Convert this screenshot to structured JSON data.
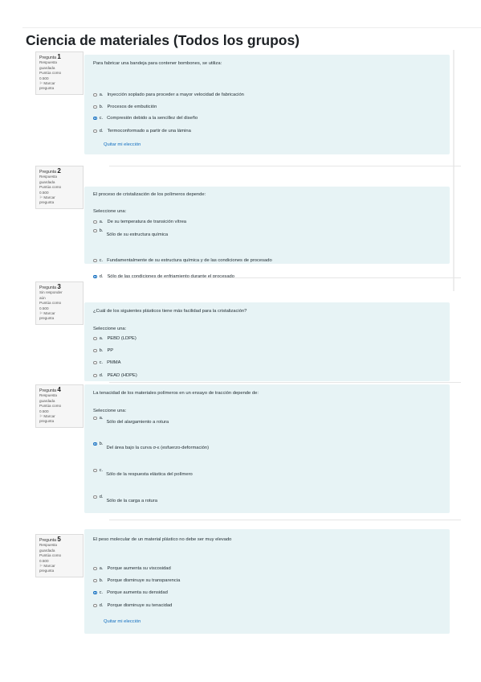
{
  "title": "Ciencia de materiales (Todos los grupos)",
  "q_label": "Pregunta",
  "questions": [
    {
      "number": "1",
      "status": [
        "Respuesta",
        "guardada"
      ],
      "points": [
        "Puntúa como",
        "0.500"
      ],
      "flag": [
        "Marcar",
        "pregunta"
      ],
      "text": "Para fabricar una bandeja para contener bombones, se utiliza:",
      "prompt": "",
      "options": [
        {
          "letter": "a.",
          "text": "Inyección soplado para proceder a mayor velocidad de fabricación",
          "selected": false
        },
        {
          "letter": "b.",
          "text": "Procesos de embutición",
          "selected": false
        },
        {
          "letter": "c.",
          "text": "Compresión debido a la sencillez del diseño",
          "selected": true
        },
        {
          "letter": "d.",
          "text": "Termoconformado a partir de una lámina",
          "selected": false
        }
      ],
      "clear": "Quitar mi elección"
    },
    {
      "number": "2",
      "status": [
        "Respuesta",
        "guardada"
      ],
      "points": [
        "Puntúa como",
        "0.500"
      ],
      "flag": [
        "Marcar",
        "pregunta"
      ],
      "text": "El proceso de cristalización de los polímeros depende:",
      "prompt": "Seleccione una:",
      "options": [
        {
          "letter": "a.",
          "text": "De su temperatura de transición vítrea",
          "selected": false
        },
        {
          "letter": "b.",
          "text": "Sólo de su estructura química",
          "selected": false
        },
        {
          "letter": "c.",
          "text": "Fundamentalmente de su estructura química y de las condiciones de procesado",
          "selected": false
        },
        {
          "letter": "d.",
          "text": "Sólo de las condiciones de enfriamiento durante el procesado",
          "selected": true
        }
      ],
      "clear": ""
    },
    {
      "number": "3",
      "status": [
        "Sin responder",
        "aún"
      ],
      "points": [
        "Puntúa como",
        "0.500"
      ],
      "flag": [
        "Marcar",
        "pregunta"
      ],
      "text": "¿Cuál de los siguientes plásticos tiene más facilidad para la cristalización?",
      "prompt": "Seleccione una:",
      "options": [
        {
          "letter": "a.",
          "text": "PEBD (LDPE)",
          "selected": false
        },
        {
          "letter": "b.",
          "text": "PP",
          "selected": false
        },
        {
          "letter": "c.",
          "text": "PMMA",
          "selected": false
        },
        {
          "letter": "d.",
          "text": "PEAD (HDPE)",
          "selected": false
        }
      ],
      "clear": ""
    },
    {
      "number": "4",
      "status": [
        "Respuesta",
        "guardada"
      ],
      "points": [
        "Puntúa como",
        "0.500"
      ],
      "flag": [
        "Marcar",
        "pregunta"
      ],
      "text": "La tenacidad de los materiales polímeros en un ensayo de tracción depende de:",
      "prompt": "Seleccione una:",
      "options": [
        {
          "letter": "a.",
          "text": "Sólo del alargamiento a rotura",
          "selected": false
        },
        {
          "letter": "b.",
          "text": "Del área bajo la curva σ-ε (esfuerzo-deformación)",
          "selected": true
        },
        {
          "letter": "c.",
          "text": "Sólo de la respuesta elástica del polímero",
          "selected": false
        },
        {
          "letter": "d.",
          "text": "Sólo de la carga a rotura",
          "selected": false
        }
      ],
      "clear": ""
    },
    {
      "number": "5",
      "status": [
        "Respuesta",
        "guardada"
      ],
      "points": [
        "Puntúa como",
        "0.500"
      ],
      "flag": [
        "Marcar",
        "pregunta"
      ],
      "text": "El peso molecular de un material plástico no debe ser muy elevado",
      "prompt": "",
      "options": [
        {
          "letter": "a.",
          "text": "Porque aumenta su viscosidad",
          "selected": false
        },
        {
          "letter": "b.",
          "text": "Porque disminuye su transparencia",
          "selected": false
        },
        {
          "letter": "c.",
          "text": "Porque aumenta su densidad",
          "selected": true
        },
        {
          "letter": "d.",
          "text": "Porque disminuye su tenacidad",
          "selected": false
        }
      ],
      "clear": "Quitar mi elección"
    }
  ]
}
